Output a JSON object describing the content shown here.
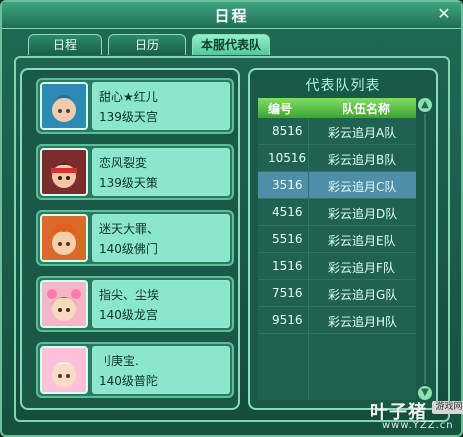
{
  "window": {
    "title": "日程"
  },
  "tabs": [
    {
      "label": "日程"
    },
    {
      "label": "日历"
    },
    {
      "label": "本服代表队"
    }
  ],
  "players": [
    {
      "name": "甜心★红儿",
      "level": "139级天宫",
      "avatar": "avatar-blue-hair"
    },
    {
      "name": "恋风裂変",
      "level": "139级天策",
      "avatar": "avatar-red-headband"
    },
    {
      "name": "迷天大罪、",
      "level": "140级佛门",
      "avatar": "avatar-orange-hair"
    },
    {
      "name": "指尖、尘埃",
      "level": "140级龙宫",
      "avatar": "avatar-pink-bow"
    },
    {
      "name": "刂庚宝.",
      "level": "140级普陀",
      "avatar": "avatar-silver-hood"
    }
  ],
  "team_list": {
    "title": "代表队列表",
    "columns": [
      "编号",
      "队伍名称"
    ],
    "rows": [
      {
        "id": "8516",
        "name": "彩云追月A队"
      },
      {
        "id": "10516",
        "name": "彩云追月B队"
      },
      {
        "id": "3516",
        "name": "彩云追月C队"
      },
      {
        "id": "4516",
        "name": "彩云追月D队"
      },
      {
        "id": "5516",
        "name": "彩云追月E队"
      },
      {
        "id": "1516",
        "name": "彩云追月F队"
      },
      {
        "id": "7516",
        "name": "彩云追月G队"
      },
      {
        "id": "9516",
        "name": "彩云追月H队"
      }
    ],
    "selected_index": 2
  },
  "watermark": {
    "brand": "叶子猪",
    "badge": "游戏网",
    "url": "www.YZZ.cn"
  },
  "icons": {
    "close": "close-icon",
    "scroll_up": "scroll-up-icon",
    "scroll_down": "scroll-down-icon"
  }
}
